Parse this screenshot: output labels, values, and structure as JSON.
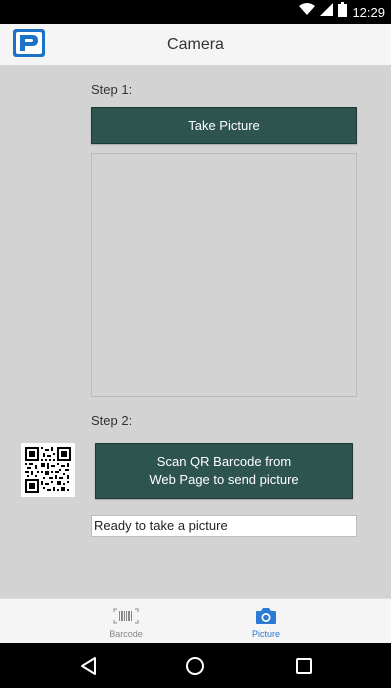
{
  "status_bar": {
    "time": "12:29",
    "icons": [
      "wifi-icon",
      "cell-signal-icon",
      "battery-icon"
    ]
  },
  "app_bar": {
    "title": "Camera",
    "logo": "app-logo-icon"
  },
  "main": {
    "step1_label": "Step 1:",
    "take_picture_label": "Take Picture",
    "step2_label": "Step 2:",
    "scan_button_line1": "Scan QR Barcode from",
    "scan_button_line2": "Web Page to send picture",
    "status_text": "Ready to take a picture"
  },
  "tabs": [
    {
      "label": "Barcode",
      "icon": "barcode-icon",
      "active": false
    },
    {
      "label": "Picture",
      "icon": "camera-icon",
      "active": true
    }
  ],
  "nav": {
    "buttons": [
      "back-icon",
      "home-icon",
      "recents-icon"
    ]
  },
  "colors": {
    "button_bg": "#2e5450",
    "content_bg": "#d3d3d3",
    "active_tab": "#2b7bd6",
    "bar_bg": "#f5f5f5"
  }
}
